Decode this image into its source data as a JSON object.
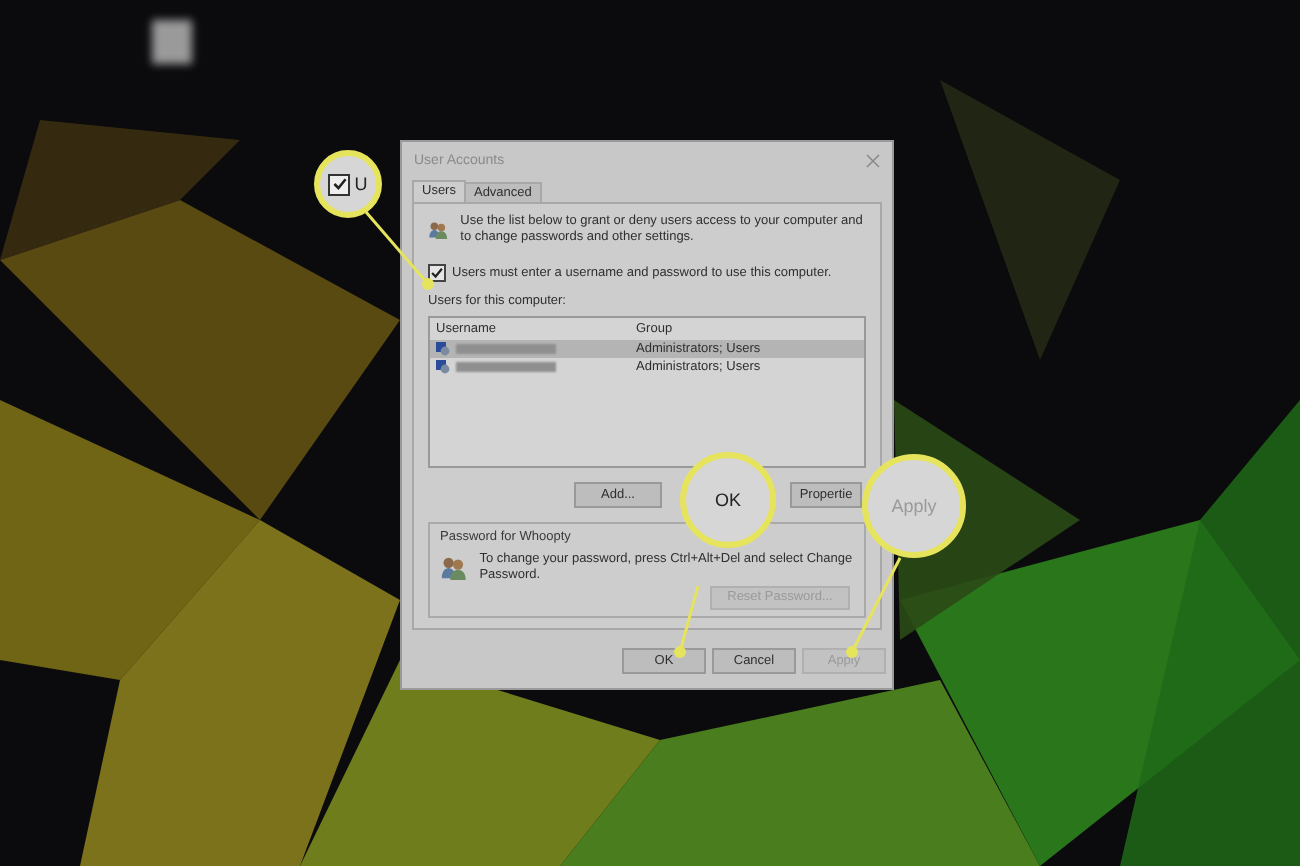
{
  "dialog": {
    "title": "User Accounts",
    "tabs": [
      {
        "label": "Users",
        "selected": true
      },
      {
        "label": "Advanced",
        "selected": false
      }
    ],
    "description": "Use the list below to grant or deny users access to your computer and to change passwords and other settings.",
    "require_password": {
      "label": "Users must enter a username and password to use this computer.",
      "checked": true
    },
    "users_label": "Users for this computer:",
    "table": {
      "columns": [
        "Username",
        "Group"
      ],
      "rows": [
        {
          "group": "Administrators; Users",
          "selected": true
        },
        {
          "group": "Administrators; Users",
          "selected": false
        }
      ]
    },
    "user_buttons": [
      {
        "label": "Add...",
        "disabled": false
      },
      {
        "label": "Propertie",
        "disabled": false
      }
    ],
    "password_group": {
      "title": "Password for Whoopty",
      "text": "To change your password, press Ctrl+Alt+Del and select Change Password.",
      "button": {
        "label": "Reset Password...",
        "disabled": true
      }
    },
    "footer_buttons": [
      {
        "label": "OK",
        "disabled": false
      },
      {
        "label": "Cancel",
        "disabled": false
      },
      {
        "label": "Apply",
        "disabled": true
      }
    ]
  },
  "callouts": [
    {
      "kind": "checkbox",
      "text": "U",
      "checked": true
    },
    {
      "kind": "button",
      "text": "OK",
      "disabled": false
    },
    {
      "kind": "button",
      "text": "Apply",
      "disabled": true
    }
  ]
}
